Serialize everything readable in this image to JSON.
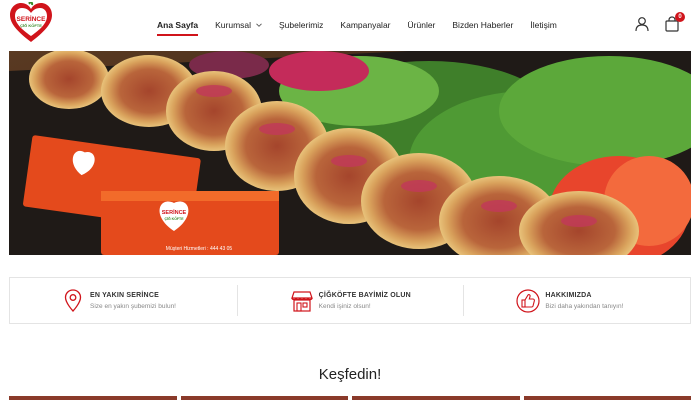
{
  "brand": {
    "logo_line1": "SERİNCE",
    "logo_line2": "ÇİĞ KÖFTE",
    "accent": "#d0141b"
  },
  "nav": {
    "items": [
      {
        "label": "Ana Sayfa",
        "active": true
      },
      {
        "label": "Kurumsal",
        "has_dropdown": true
      },
      {
        "label": "Şubelerimiz"
      },
      {
        "label": "Kampanyalar"
      },
      {
        "label": "Ürünler"
      },
      {
        "label": "Bizden Haberler"
      },
      {
        "label": "İletişim"
      }
    ]
  },
  "header": {
    "user_icon": "user-icon",
    "cart_icon": "shopping-bag-icon",
    "cart_count": "0"
  },
  "banner": {
    "packet_brand": "SERİNCE",
    "packet_brand2": "ÇİĞ KÖFTE",
    "packet_service": "Müşteri Hizmetleri : 444 43 05"
  },
  "features": [
    {
      "title": "EN YAKIN SERİNCE",
      "subtitle": "Size en yakın şubemizi bulun!",
      "icon": "map-pin-icon"
    },
    {
      "title": "ÇİĞKÖFTE BAYİMİZ OLUN",
      "subtitle": "Kendi işiniz olsun!",
      "icon": "store-icon"
    },
    {
      "title": "HAKKIMIZDA",
      "subtitle": "Bizi daha yakından tanıyın!",
      "icon": "thumbs-up-icon"
    }
  ],
  "discover": {
    "title": "Keşfedin!"
  }
}
